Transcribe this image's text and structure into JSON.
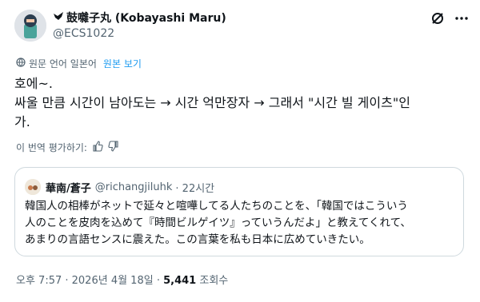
{
  "author": {
    "display_name": "鼓囃子丸 (Kobayashi Maru)",
    "handle": "@ECS1022"
  },
  "translation": {
    "label": "원문 언어 일본어",
    "show_original": "원본 보기"
  },
  "tweet": {
    "line1": "호에~.",
    "line2": "싸울 만큼 시간이 남아도는 → 시간 억만장자 → 그래서 \"시간 빌 게이츠\"인",
    "line3": "가."
  },
  "rate_translation": "이 번역 평가하기:",
  "quoted": {
    "display_name": "華南/蒼子",
    "handle": "@richangjiluhk",
    "time": "· 22시간",
    "line1": "韓国人の相棒がネットで延々と喧嘩してる人たちのことを、「韓国ではこういう",
    "line2": "人のことを皮肉を込めて『時間ビルゲイツ』っていうんだよ」と教えてくれて、",
    "line3": "あまりの言語センスに震えた。この言葉を私も日本に広めていきたい。"
  },
  "footer": {
    "datetime": "오후 7:57 · 2026년 4월 18일 ·",
    "views": "5,441",
    "views_label": "조회수"
  },
  "colors": {
    "link": "#1d9bf0",
    "muted": "#536471",
    "border": "#cfd9de"
  }
}
